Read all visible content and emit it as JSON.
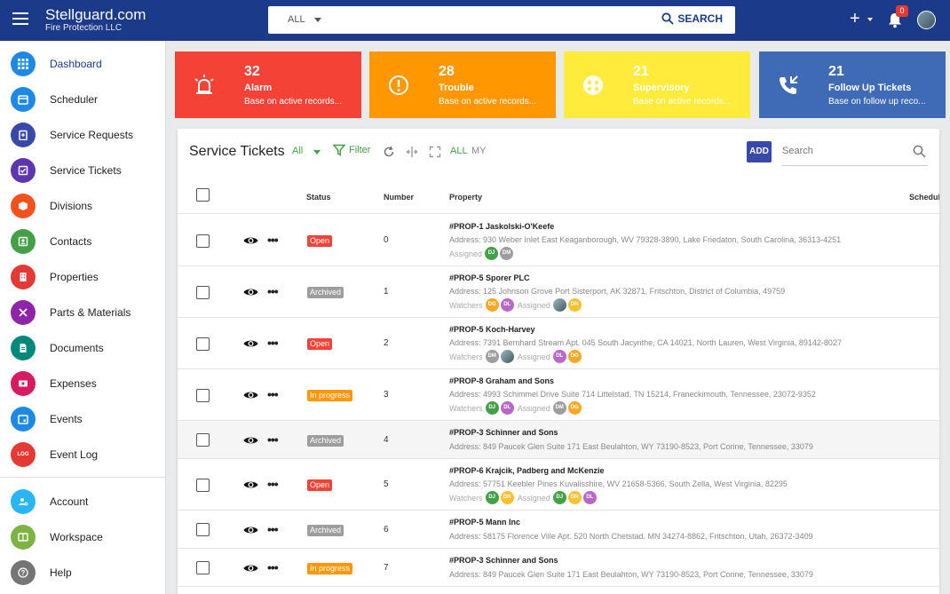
{
  "app": {
    "brand_title": "Stellguard.com",
    "brand_subtitle": "Fire Protection LLC",
    "search_scope": "ALL",
    "search_button": "SEARCH",
    "notifications_count": "0",
    "plus_label": "+"
  },
  "sidebar": {
    "items": [
      {
        "label": "Dashboard",
        "icon": "grid-icon",
        "color": "#1e88e5"
      },
      {
        "label": "Scheduler",
        "icon": "calendar-icon",
        "color": "#1e88e5"
      },
      {
        "label": "Service Requests",
        "icon": "clipboard-icon",
        "color": "#3949ab"
      },
      {
        "label": "Service Tickets",
        "icon": "ticket-icon",
        "color": "#5e35b1"
      },
      {
        "label": "Divisions",
        "icon": "cube-icon",
        "color": "#f4511e"
      },
      {
        "label": "Contacts",
        "icon": "contacts-icon",
        "color": "#43a047"
      },
      {
        "label": "Properties",
        "icon": "building-icon",
        "color": "#e53935"
      },
      {
        "label": "Parts & Materials",
        "icon": "tools-icon",
        "color": "#8e24aa"
      },
      {
        "label": "Documents",
        "icon": "document-icon",
        "color": "#00897b"
      },
      {
        "label": "Expenses",
        "icon": "money-icon",
        "color": "#d81b60"
      },
      {
        "label": "Events",
        "icon": "event-icon",
        "color": "#1e88e5"
      },
      {
        "label": "Event Log",
        "icon": "log-icon",
        "color": "#e53935",
        "badge": "LOG"
      }
    ],
    "bottom_items": [
      {
        "label": "Account",
        "icon": "account-icon",
        "color": "#29b6f6"
      },
      {
        "label": "Workspace",
        "icon": "workspace-icon",
        "color": "#7cb342"
      },
      {
        "label": "Help",
        "icon": "help-icon",
        "color": "#757575"
      }
    ]
  },
  "cards": [
    {
      "count": "32",
      "title": "Alarm",
      "subtitle": "Base on active records...",
      "color": "#f44336",
      "icon": "alarm-icon"
    },
    {
      "count": "28",
      "title": "Trouble",
      "subtitle": "Base on active records...",
      "color": "#ff9800",
      "icon": "trouble-icon"
    },
    {
      "count": "21",
      "title": "Supervisory",
      "subtitle": "Base on active records...",
      "color": "#ffeb3b",
      "icon": "supervisory-icon"
    },
    {
      "count": "21",
      "title": "Follow Up Tickets",
      "subtitle": "Base on follow up reco...",
      "color": "#3f6ab5",
      "icon": "phone-callback-icon"
    }
  ],
  "panel": {
    "title": "Service Tickets",
    "filter_scope": "All",
    "filter_label": "Filter",
    "scope_all": "ALL",
    "scope_my": "MY",
    "add_label": "ADD",
    "search_placeholder": "Search"
  },
  "table": {
    "headers": {
      "status": "Status",
      "number": "Number",
      "property": "Property",
      "schedule": "Schedul"
    },
    "status_colors": {
      "Open": "#f44336",
      "Archived": "#9e9e9e",
      "In progress": "#ff9800"
    },
    "rows": [
      {
        "status": "Open",
        "number": "0",
        "property": "#PROP-1 Jaskolski-O'Keefe",
        "address": "Address: 930 Weber Inlet East Keaganborough, WV 79328-3890, Lake Friedaton, South Carolina, 36313-4251",
        "watchers": [],
        "assigned": [
          "DJ",
          "DM"
        ]
      },
      {
        "status": "Archived",
        "number": "1",
        "property": "#PROP-5 Sporer PLC",
        "address": "Address: 125 Johnson Grove Port Sisterport, AK 32871, Fritschton, District of Columbia, 49759",
        "watchers": [
          "DG",
          "DL"
        ],
        "assigned": [
          "@",
          "DN"
        ]
      },
      {
        "status": "Open",
        "number": "2",
        "property": "#PROP-5 Koch-Harvey",
        "address": "Address: 7391 Bernhard Stream Apt. 045 South Jacynthe, CA 14021, North Lauren, West Virginia, 89142-8027",
        "watchers": [
          "DM",
          "@"
        ],
        "assigned": [
          "DL",
          "DG"
        ]
      },
      {
        "status": "In progress",
        "number": "3",
        "property": "#PROP-8 Graham and Sons",
        "address": "Address: 4993 Schimmel Drive Suite 714 Littelstad, TN 15214, Franeckimouth, Tennessee, 23072-9352",
        "watchers": [
          "DJ",
          "DL"
        ],
        "assigned": [
          "DM",
          "DG"
        ]
      },
      {
        "status": "Archived",
        "number": "4",
        "property": "#PROP-3 Schinner and Sons",
        "address": "Address: 849 Paucek Glen Suite 171 East Beulahton, WY 73190-8523, Port Corine, Tennessee, 33079",
        "watchers": [],
        "assigned": []
      },
      {
        "status": "Open",
        "number": "5",
        "property": "#PROP-6 Krajcik, Padberg and McKenzie",
        "address": "Address: 57751 Keebler Pines Kuvalisshire, WV 21658-5366, South Zella, West Virginia, 82295",
        "watchers": [
          "DJ",
          "DN"
        ],
        "assigned": [
          "DJ",
          "DN",
          "DL"
        ]
      },
      {
        "status": "Archived",
        "number": "6",
        "property": "#PROP-5 Mann Inc",
        "address": "Address: 58175 Florence Ville Apt. 520 North Chetstad, MN 34274-8862, Fritschton, Utah, 26372-3409",
        "watchers": [],
        "assigned": []
      },
      {
        "status": "In progress",
        "number": "7",
        "property": "#PROP-3 Schinner and Sons",
        "address": "Address: 849 Paucek Glen Suite 171 East Beulahton, WY 73190-8523, Port Corine, Tennessee, 33079",
        "watchers": [],
        "assigned": []
      }
    ],
    "watchers_label": "Watchers",
    "assigned_label": "Assigned",
    "avatar_colors": {
      "DJ": "#43a047",
      "DM": "#9e9e9e",
      "DG": "#f9a825",
      "DL": "#ba68c8",
      "DN": "#fbc02d"
    }
  }
}
